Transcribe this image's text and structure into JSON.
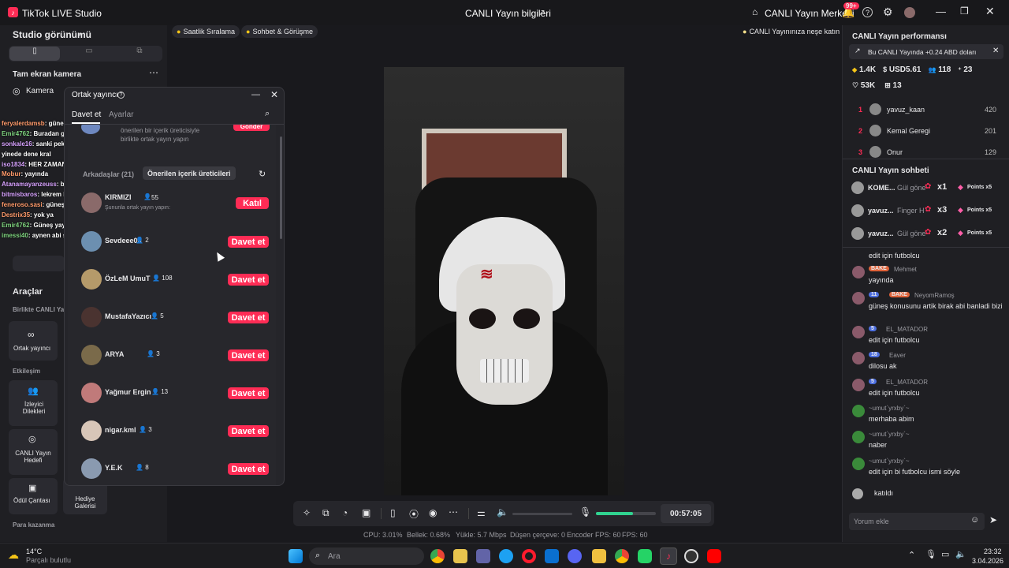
{
  "titlebar": {
    "app_name": "TikTok LIVE Studio",
    "center_title": "CANLI Yayın bilgileri",
    "live_center": "CANLI Yayın Merkezi",
    "notif_badge": "99+"
  },
  "left": {
    "studio_view": "Studio görünümü",
    "fullscreen_camera": "Tam ekran kamera",
    "camera": "Kamera",
    "tools_title": "Araçlar",
    "live_together": "Birlikte CANLI Ya",
    "cohost": "Ortak yayıncı",
    "engagement": "Etkileşim",
    "viewer_requests": "İzleyici Dilekleri",
    "live_goal": "CANLI Yayın Hedefi",
    "reward_bag": "Ödül Çantası",
    "gift_gallery": "Hediye Galerisi",
    "earn": "Para kazanma"
  },
  "top_chips": {
    "hourly": "Saatlik Sıralama",
    "chat_meet": "Sohbet & Görüşme",
    "hint": "CANLI Yayınınıza neşe katın"
  },
  "dialog": {
    "title": "Ortak yayıncı",
    "tab_invite": "Davet et",
    "tab_settings": "Ayarlar",
    "suggested_line1": "önerilen bir içerik üreticisiyle",
    "suggested_line2": "birlikte ortak yayın yapın",
    "top_btn": "Gönder",
    "tab_friends": "Arkadaşlar (21)",
    "tab_suggested": "Önerilen içerik üreticileri",
    "live_user": {
      "name": "KIRMIZI",
      "count": "55",
      "sub": "Şununla ortak yayın yapın:",
      "btn": "Katıl"
    },
    "invite_btn": "Davet et",
    "users": [
      {
        "name": "Sevdeee05",
        "count": "2"
      },
      {
        "name": "ÖzLeM UmuT",
        "count": "108"
      },
      {
        "name": "MustafaYazıcı",
        "count": "5"
      },
      {
        "name": "ARYA",
        "count": "3"
      },
      {
        "name": "Yağmur Ergin",
        "count": "13"
      },
      {
        "name": "nigar.kml",
        "count": "3"
      },
      {
        "name": "Y.E.K",
        "count": "8"
      }
    ]
  },
  "overlay_chat": [
    {
      "user": "feryalerdamsb",
      "msg": "güneşin chat e gidin eklesin",
      "cls": "o"
    },
    {
      "user": "Emir4762",
      "msg": "Buradan gelmez",
      "cls": "n"
    },
    {
      "user": "sonkale16",
      "msg": "sanki pek belirir bir durum yok gibi ama sen",
      "cls": "p"
    },
    {
      "user": "",
      "msg": "yinede dene kral",
      "cls": ""
    },
    {
      "user": "iso1834",
      "msg": "HER ZAMAN ARKANDAYIZ ABİ @bakemask",
      "cls": "p"
    },
    {
      "user": "Mobur",
      "msg": "yayında",
      "cls": "o"
    },
    {
      "user": "Atanamayanzeuss",
      "msg": "beyler bi el atalım olaya artık",
      "cls": "p"
    },
    {
      "user": "bitmisbaros",
      "msg": "lekrem başka güneş bulamazsın sıkıntı yok",
      "cls": "p"
    },
    {
      "user": "feneroso.sasi",
      "msg": "güneşin yayına gidip istek atbralım",
      "cls": "o"
    },
    {
      "user": "Destrix35",
      "msg": "yok ya",
      "cls": "o"
    },
    {
      "user": "Emir4762",
      "msg": "Güneş yayında",
      "cls": "n"
    },
    {
      "user": "imessi40",
      "msg": "aynen abi senden hamle bekliyor sende engelle",
      "cls": "n"
    }
  ],
  "right": {
    "perf_title": "CANLI Yayın performansı",
    "earn_banner": "Bu CANLI Yayında +0.24 ABD doları",
    "stats": {
      "diamonds": "1.4K",
      "usd": "USD5.61",
      "viewers": "118",
      "new_followers": "23",
      "likes": "53K",
      "gifters": "13"
    },
    "ranking": [
      {
        "rank": "1",
        "name": "yavuz_kaan",
        "score": "420"
      },
      {
        "rank": "2",
        "name": "Kemal Geregi",
        "score": "201"
      },
      {
        "rank": "3",
        "name": "Onur",
        "score": "129"
      }
    ],
    "chat_title": "CANLI Yayın sohbeti",
    "gifts": [
      {
        "name": "KOME...",
        "gift": "Gül göne",
        "mult": "x1",
        "points": "Points x5"
      },
      {
        "name": "yavuz...",
        "gift": "Finger H",
        "mult": "x3",
        "points": "Points x5"
      },
      {
        "name": "yavuz...",
        "gift": "Gül göne",
        "mult": "x2",
        "points": "Points x5"
      }
    ],
    "chat": [
      {
        "badge": "",
        "level": "",
        "user": "",
        "msg": "edit için futbolcu"
      },
      {
        "badge": "BAKE",
        "level": "",
        "user": "Mehmet",
        "msg": "yayında"
      },
      {
        "badge": "BAKE",
        "level": "11",
        "user": "NeyomRamoş",
        "msg": "güneş konusunu artik birak abi banladi bizi"
      },
      {
        "badge": "",
        "level": "5",
        "user": "EL_MATADOR",
        "msg": "edit için futbolcu"
      },
      {
        "badge": "",
        "level": "18",
        "user": "Eaver",
        "msg": "dilosu ak"
      },
      {
        "badge": "",
        "level": "5",
        "user": "EL_MATADOR",
        "msg": "edit için futbolcu"
      },
      {
        "badge": "",
        "level": "",
        "user": "~umut`yrxby`~",
        "msg": "merhaba abim"
      },
      {
        "badge": "",
        "level": "",
        "user": "~umut`yrxby`~",
        "msg": "naber"
      },
      {
        "badge": "",
        "level": "",
        "user": "~umut`yrxby`~",
        "msg": "edit için bi futbolcu ismi söyle"
      }
    ],
    "joined": "katıldı",
    "comment_placeholder": "Yorum ekle"
  },
  "controls": {
    "timer": "00:57:05",
    "volume_level": 0.0,
    "mic_level": 0.62
  },
  "stats": {
    "cpu": "CPU: 3.01%",
    "mem": "Bellek: 0.68%",
    "upload": "Yükle: 5.7 Mbps",
    "dropped": "Düşen çerçeve: 0",
    "encoder_fps": "Encoder FPS: 60",
    "fps": "FPS: 60"
  },
  "taskbar": {
    "temp": "14°C",
    "weather": "Parçalı bulutlu",
    "search": "Ara",
    "time": "23:32",
    "date": "3.04.2026"
  },
  "colors": {
    "accent": "#fe2c55",
    "bg": "#1b1b1f"
  }
}
